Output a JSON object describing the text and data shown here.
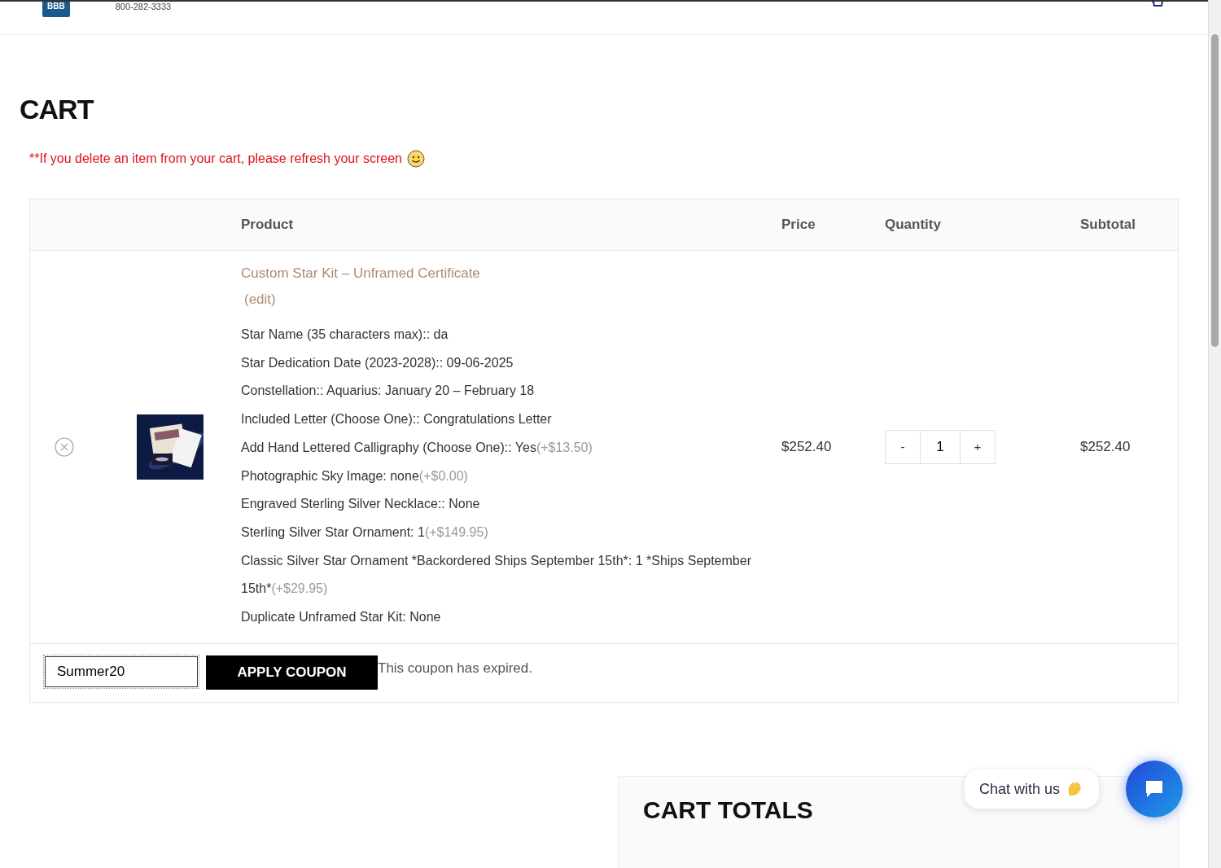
{
  "header": {
    "logo": "BBB",
    "phone": "800-282-3333"
  },
  "page_title": "CART",
  "notice": "**If you delete an item from your cart, please refresh your screen",
  "table": {
    "columns": [
      "Product",
      "Price",
      "Quantity",
      "Subtotal"
    ],
    "rows": [
      {
        "name": "Custom Star Kit – Unframed Certificate",
        "edit": "(edit)",
        "meta": [
          {
            "label": "Star Name (35 characters max):",
            "value": ": da"
          },
          {
            "label": "Star Dedication Date (2023-2028):",
            "value": ": 09-06-2025"
          },
          {
            "label": "Constellation:",
            "value": ": Aquarius: January 20 – February 18"
          },
          {
            "label": "Included Letter (Choose One):",
            "value": ": Congratulations Letter"
          },
          {
            "label": "Add Hand Lettered Calligraphy (Choose One):",
            "value": ": Yes",
            "extra": "(+$13.50)"
          },
          {
            "label": "Photographic Sky Image:",
            "value": " none",
            "extra": "(+$0.00)"
          },
          {
            "label": "Engraved Sterling Silver Necklace:",
            "value": ": None"
          },
          {
            "label": "Sterling Silver Star Ornament:",
            "value": " 1",
            "extra": "(+$149.95)"
          },
          {
            "label": "Classic Silver Star Ornament *Backordered Ships September 15th*:",
            "value": " 1 *Ships September 15th*",
            "extra": "(+$29.95)"
          },
          {
            "label": "Duplicate Unframed Star Kit:",
            "value": " None"
          }
        ],
        "price": "$252.40",
        "minus": "-",
        "quantity": "1",
        "plus": "+",
        "subtotal": "$252.40"
      }
    ]
  },
  "coupon": {
    "value": "Summer20",
    "button": "APPLY COUPON",
    "message": "This coupon has expired."
  },
  "cart_totals": {
    "title": "CART TOTALS"
  },
  "chat": {
    "label": "Chat with us"
  }
}
